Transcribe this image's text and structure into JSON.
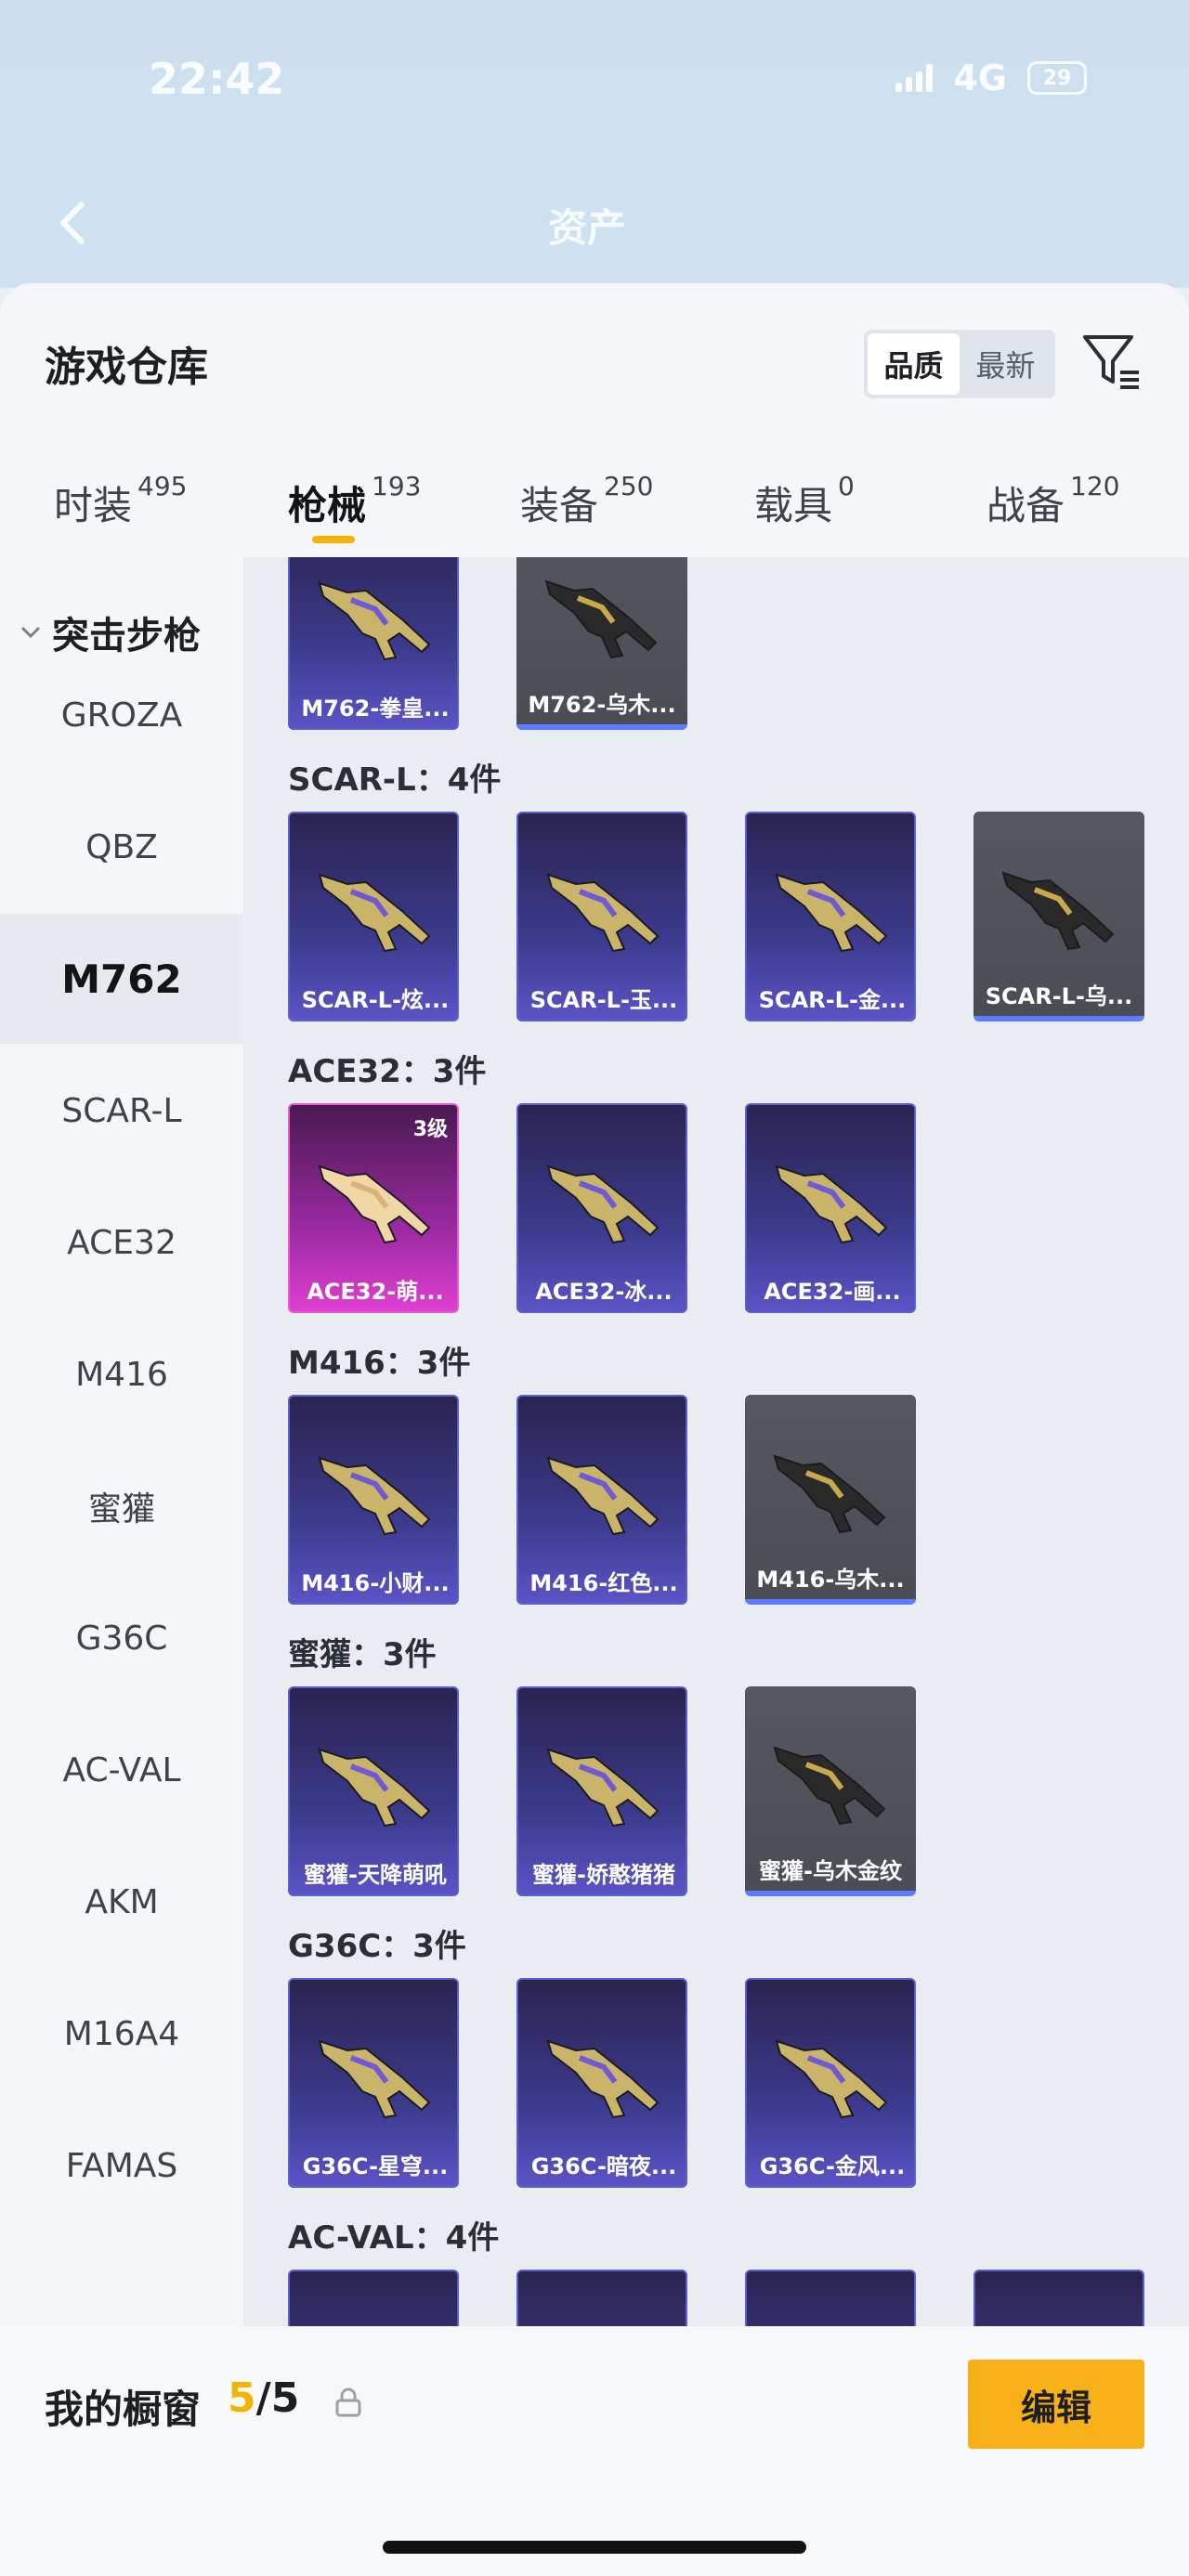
{
  "status_bar": {
    "time": "22:42",
    "network": "4G",
    "battery": "29"
  },
  "nav": {
    "title": "资产"
  },
  "sheet": {
    "title": "游戏仓库",
    "sort": {
      "quality": "品质",
      "newest": "最新"
    }
  },
  "tabs": [
    {
      "label": "时装",
      "count": "495"
    },
    {
      "label": "枪械",
      "count": "193"
    },
    {
      "label": "装备",
      "count": "250"
    },
    {
      "label": "载具",
      "count": "0"
    },
    {
      "label": "战备",
      "count": "120"
    }
  ],
  "sidebar": {
    "group": "突击步枪",
    "items": [
      "GROZA",
      "QBZ",
      "M762",
      "SCAR-L",
      "ACE32",
      "M416",
      "蜜獾",
      "G36C",
      "AC-VAL",
      "AKM",
      "M16A4",
      "FAMAS"
    ]
  },
  "groups": [
    {
      "label": "",
      "cards": [
        {
          "name": "M762-拳皇...",
          "style": "purple"
        },
        {
          "name": "M762-乌木...",
          "style": "gray"
        }
      ]
    },
    {
      "label": "SCAR-L：4件",
      "cards": [
        {
          "name": "SCAR-L-炫...",
          "style": "purple"
        },
        {
          "name": "SCAR-L-玉...",
          "style": "purple"
        },
        {
          "name": "SCAR-L-金...",
          "style": "purple"
        },
        {
          "name": "SCAR-L-乌...",
          "style": "gray"
        }
      ]
    },
    {
      "label": "ACE32：3件",
      "cards": [
        {
          "name": "ACE32-萌...",
          "style": "pink",
          "level": "3级"
        },
        {
          "name": "ACE32-冰...",
          "style": "purple"
        },
        {
          "name": "ACE32-画...",
          "style": "purple"
        }
      ]
    },
    {
      "label": "M416：3件",
      "cards": [
        {
          "name": "M416-小财...",
          "style": "purple"
        },
        {
          "name": "M416-红色...",
          "style": "purple"
        },
        {
          "name": "M416-乌木...",
          "style": "gray"
        }
      ]
    },
    {
      "label": "蜜獾：3件",
      "cards": [
        {
          "name": "蜜獾-天降萌吼",
          "style": "purple"
        },
        {
          "name": "蜜獾-娇憨猪猪",
          "style": "purple"
        },
        {
          "name": "蜜獾-乌木金纹",
          "style": "gray"
        }
      ]
    },
    {
      "label": "G36C：3件",
      "cards": [
        {
          "name": "G36C-星穹...",
          "style": "purple"
        },
        {
          "name": "G36C-暗夜...",
          "style": "purple"
        },
        {
          "name": "G36C-金风...",
          "style": "purple"
        }
      ]
    },
    {
      "label": "AC-VAL：4件",
      "cards": [
        {
          "name": "",
          "style": "purple"
        },
        {
          "name": "",
          "style": "purple"
        },
        {
          "name": "",
          "style": "purple"
        },
        {
          "name": "",
          "style": "purple"
        }
      ]
    }
  ],
  "bottom": {
    "showcase_label": "我的橱窗",
    "showcase_current": "5",
    "showcase_total": "/5",
    "edit_label": "编辑"
  },
  "colors": {
    "accent": "#f5b400",
    "card_purple": "#3c3a8c",
    "card_pink": "#de3fcf",
    "card_gray": "#4a4e54"
  },
  "icons": [
    "back-arrow-icon",
    "filter-icon",
    "chevron-down-icon",
    "share-export-icon",
    "lock-icon",
    "weapon-icon"
  ]
}
